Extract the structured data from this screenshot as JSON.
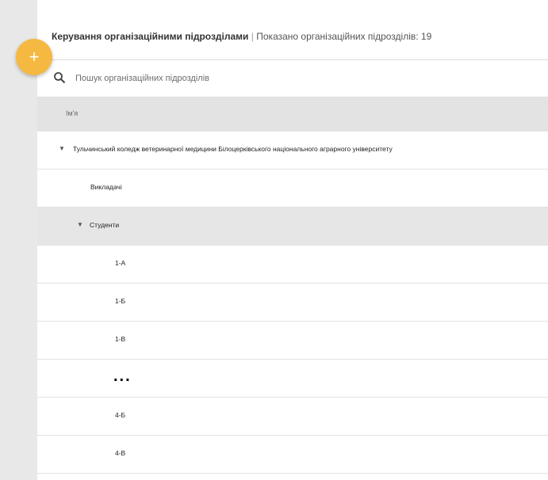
{
  "header": {
    "title": "Керування організаційними підрозділами",
    "separator": "|",
    "count_text": "Показано організаційних підрозділів: 19"
  },
  "fab": {
    "label": "+"
  },
  "search": {
    "placeholder": "Пошук організаційних підрозділів",
    "value": ""
  },
  "table": {
    "column_name": "Ім'я"
  },
  "tree": [
    {
      "label": "Тульчинський коледж ветеринарної медицини Білоцерківського національного аграрного університету",
      "expanded": true,
      "level": 0
    },
    {
      "label": "Викладачі",
      "level": 1
    },
    {
      "label": "Студенти",
      "expanded": true,
      "level": 1,
      "selected": true
    },
    {
      "label": "1-А",
      "level": 2
    },
    {
      "label": "1-Б",
      "level": 2
    },
    {
      "label": "1-В",
      "level": 2
    },
    {
      "label": "...",
      "level": 2
    },
    {
      "label": "4-Б",
      "level": 2
    },
    {
      "label": "4-В",
      "level": 2
    }
  ],
  "icons": {
    "caret": "caret-down-icon",
    "search": "search-icon",
    "add": "plus-icon"
  },
  "colors": {
    "fab": "#f5b942",
    "header_bar": "#e3e3e3",
    "selected_row": "#e6e6e6"
  }
}
